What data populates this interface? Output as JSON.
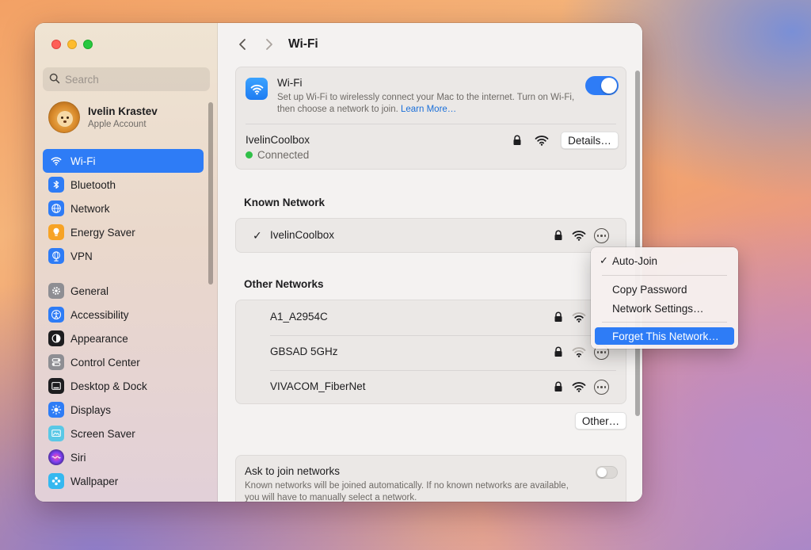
{
  "sidebar": {
    "search_placeholder": "Search",
    "account": {
      "name": "Ivelin Krastev",
      "subtitle": "Apple Account"
    },
    "items": [
      {
        "label": "Wi-Fi",
        "icon": "wifi-icon",
        "color": "#2e7cf6",
        "active": true
      },
      {
        "label": "Bluetooth",
        "icon": "bluetooth-icon",
        "color": "#2e7cf6"
      },
      {
        "label": "Network",
        "icon": "globe-icon",
        "color": "#2e7cf6"
      },
      {
        "label": "Energy Saver",
        "icon": "lightbulb-icon",
        "color": "#f7a325"
      },
      {
        "label": "VPN",
        "icon": "vpn-globe-icon",
        "color": "#2e7cf6"
      },
      {
        "label": "General",
        "icon": "gear-icon",
        "color": "#8e8e93"
      },
      {
        "label": "Accessibility",
        "icon": "accessibility-icon",
        "color": "#2e7cf6"
      },
      {
        "label": "Appearance",
        "icon": "appearance-icon",
        "color": "#1d1d1f"
      },
      {
        "label": "Control Center",
        "icon": "control-center-icon",
        "color": "#8e8e93"
      },
      {
        "label": "Desktop & Dock",
        "icon": "dock-icon",
        "color": "#1d1d1f"
      },
      {
        "label": "Displays",
        "icon": "sun-icon",
        "color": "#2e7cf6"
      },
      {
        "label": "Screen Saver",
        "icon": "screen-saver-icon",
        "color": "#5ac8e6"
      },
      {
        "label": "Siri",
        "icon": "siri-icon",
        "color": "#3a2a5a"
      },
      {
        "label": "Wallpaper",
        "icon": "wallpaper-icon",
        "color": "#35b8f0"
      }
    ]
  },
  "main": {
    "title": "Wi-Fi",
    "wifi": {
      "title": "Wi-Fi",
      "description": "Set up Wi-Fi to wirelessly connect your Mac to the internet. Turn on Wi-Fi, then choose a network to join.",
      "learn_more": "Learn More…",
      "enabled": true,
      "current_network": "IvelinCoolbox",
      "status": "Connected",
      "details_label": "Details…"
    },
    "known_title": "Known Network",
    "known": [
      {
        "name": "IvelinCoolbox",
        "checked": true,
        "locked": true
      }
    ],
    "other_title": "Other Networks",
    "other": [
      {
        "name": "A1_A2954C",
        "locked": true,
        "signal": "weak"
      },
      {
        "name": "GBSAD 5GHz",
        "locked": true,
        "signal": "weak"
      },
      {
        "name": "VIVACOM_FiberNet",
        "locked": true,
        "signal": "strong"
      }
    ],
    "other_button": "Other…",
    "ask": {
      "title": "Ask to join networks",
      "description": "Known networks will be joined automatically. If no known networks are available, you will have to manually select a network.",
      "enabled": false
    }
  },
  "context_menu": {
    "items": [
      {
        "label": "Auto-Join",
        "checked": true
      },
      {
        "label": "Copy Password"
      },
      {
        "label": "Network Settings…"
      },
      {
        "label": "Forget This Network…",
        "highlighted": true
      }
    ]
  },
  "colors": {
    "accent": "#2e7cf6",
    "connected": "#30c048"
  }
}
